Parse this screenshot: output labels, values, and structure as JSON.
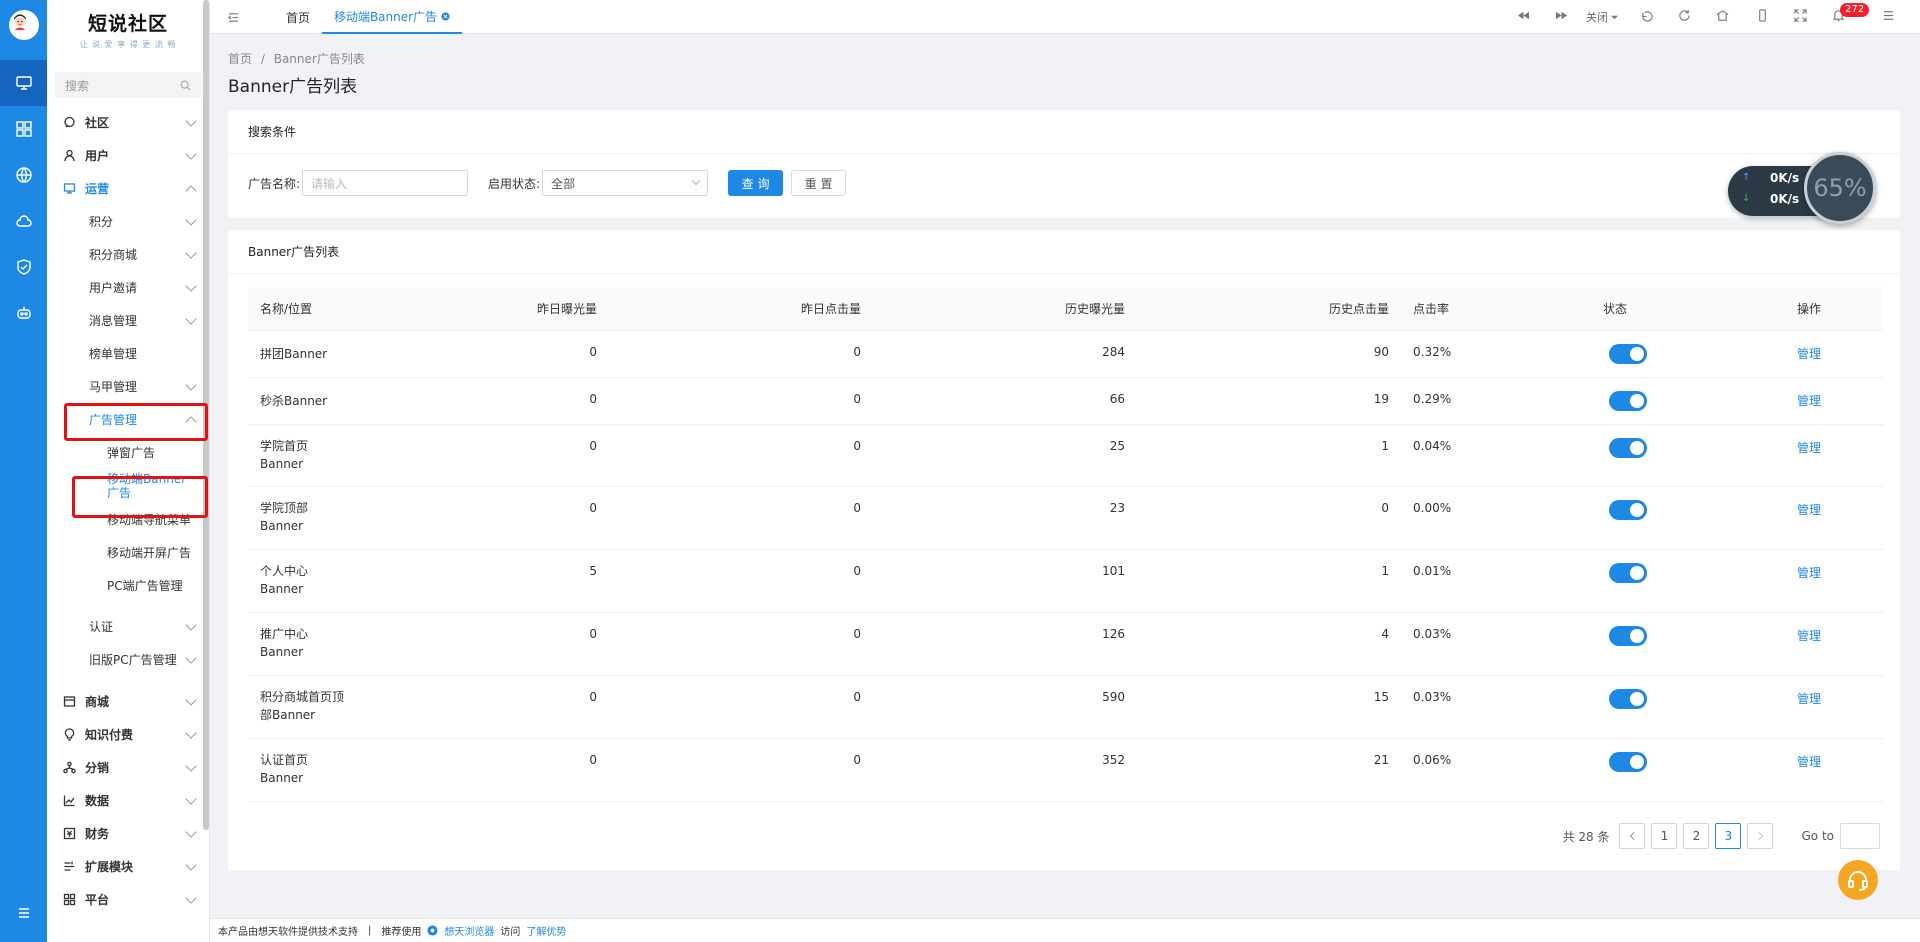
{
  "brand": {
    "title": "短说社区",
    "subtitle": "让 说 爱 享 得 更 流 畅"
  },
  "sidebar": {
    "search_placeholder": "搜索",
    "items": [
      {
        "label": "社区",
        "level": 0,
        "expanded": false
      },
      {
        "label": "用户",
        "level": 0,
        "expanded": false
      },
      {
        "label": "运营",
        "level": 0,
        "expanded": true,
        "active": true
      },
      {
        "label": "积分",
        "level": 1
      },
      {
        "label": "积分商城",
        "level": 1
      },
      {
        "label": "用户邀请",
        "level": 1
      },
      {
        "label": "消息管理",
        "level": 1
      },
      {
        "label": "榜单管理",
        "level": 1
      },
      {
        "label": "马甲管理",
        "level": 1
      },
      {
        "label": "广告管理",
        "level": 1,
        "expanded": true,
        "active": true
      },
      {
        "label": "弹窗广告",
        "level": 2
      },
      {
        "label": "移动端Banner广告",
        "level": 2,
        "active": true
      },
      {
        "label": "移动端导航菜单",
        "level": 2
      },
      {
        "label": "移动端开屏广告",
        "level": 2
      },
      {
        "label": "PC端广告管理",
        "level": 2
      },
      {
        "label": "认证",
        "level": 1
      },
      {
        "label": "旧版PC广告管理",
        "level": 1
      },
      {
        "label": "商城",
        "level": 0
      },
      {
        "label": "知识付费",
        "level": 0
      },
      {
        "label": "分销",
        "level": 0
      },
      {
        "label": "数据",
        "level": 0
      },
      {
        "label": "财务",
        "level": 0
      },
      {
        "label": "扩展模块",
        "level": 0
      },
      {
        "label": "平台",
        "level": 0
      }
    ]
  },
  "tabs": {
    "home": "首页",
    "current": "移动端Banner广告"
  },
  "toolbar": {
    "close_label": "关闭",
    "notification_count": "272"
  },
  "breadcrumb": {
    "home": "首页",
    "sep": "/",
    "current": "Banner广告列表"
  },
  "page_title": "Banner广告列表",
  "search": {
    "header": "搜索条件",
    "name_label": "广告名称:",
    "name_placeholder": "请输入",
    "status_label": "启用状态:",
    "status_value": "全部",
    "query_button": "查 询",
    "reset_button": "重 置"
  },
  "list": {
    "header": "Banner广告列表",
    "columns": [
      "名称/位置",
      "昨日曝光量",
      "昨日点击量",
      "历史曝光量",
      "历史点击量",
      "点击率",
      "状态",
      "操作"
    ],
    "rows": [
      {
        "name1": "拼团Banner",
        "name2": "",
        "y_exp": "0",
        "y_click": "0",
        "h_exp": "284",
        "h_click": "90",
        "rate": "0.32%",
        "enabled": true,
        "action": "管理"
      },
      {
        "name1": "秒杀Banner",
        "name2": "",
        "y_exp": "0",
        "y_click": "0",
        "h_exp": "66",
        "h_click": "19",
        "rate": "0.29%",
        "enabled": true,
        "action": "管理"
      },
      {
        "name1": "学院首页",
        "name2": "Banner",
        "y_exp": "0",
        "y_click": "0",
        "h_exp": "25",
        "h_click": "1",
        "rate": "0.04%",
        "enabled": true,
        "action": "管理"
      },
      {
        "name1": "学院顶部",
        "name2": "Banner",
        "y_exp": "0",
        "y_click": "0",
        "h_exp": "23",
        "h_click": "0",
        "rate": "0.00%",
        "enabled": true,
        "action": "管理"
      },
      {
        "name1": "个人中心",
        "name2": "Banner",
        "y_exp": "5",
        "y_click": "0",
        "h_exp": "101",
        "h_click": "1",
        "rate": "0.01%",
        "enabled": true,
        "action": "管理"
      },
      {
        "name1": "推广中心",
        "name2": "Banner",
        "y_exp": "0",
        "y_click": "0",
        "h_exp": "126",
        "h_click": "4",
        "rate": "0.03%",
        "enabled": true,
        "action": "管理"
      },
      {
        "name1": "积分商城首页顶",
        "name2": "部Banner",
        "y_exp": "0",
        "y_click": "0",
        "h_exp": "590",
        "h_click": "15",
        "rate": "0.03%",
        "enabled": true,
        "action": "管理"
      },
      {
        "name1": "认证首页",
        "name2": "Banner",
        "y_exp": "0",
        "y_click": "0",
        "h_exp": "352",
        "h_click": "21",
        "rate": "0.06%",
        "enabled": true,
        "action": "管理"
      }
    ]
  },
  "pagination": {
    "total": "共 28 条",
    "pages": [
      "1",
      "2",
      "3"
    ],
    "current": "3",
    "goto_label": "Go to"
  },
  "net_widget": {
    "up": "0K/s",
    "down": "0K/s",
    "percent": "65%"
  },
  "footer": {
    "powered": "本产品由想天软件提供技术支持",
    "sep": "|",
    "recommend": "推荐使用",
    "browser": "想天浏览器",
    "visit": "访问",
    "learn": "了解优势"
  }
}
